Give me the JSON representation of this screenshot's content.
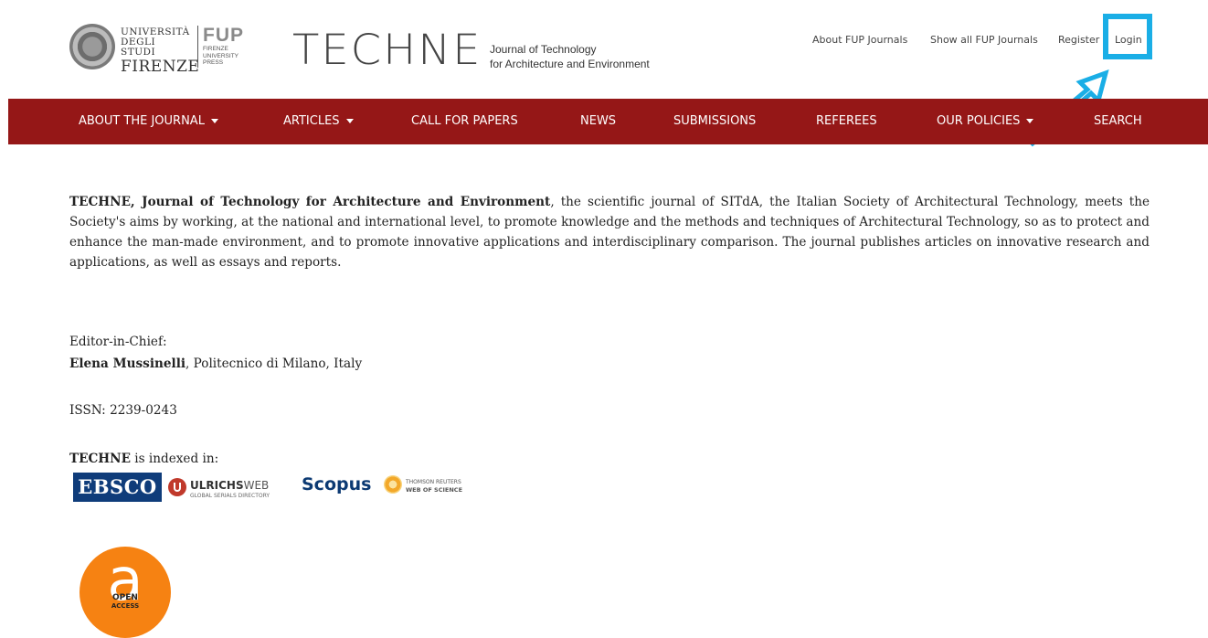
{
  "header": {
    "university": {
      "line1": "UNIVERSITÀ",
      "line2": "DEGLI STUDI",
      "line3": "FIRENZE"
    },
    "fup": {
      "big": "FUP",
      "line1": "FIRENZE",
      "line2": "UNIVERSITY",
      "line3": "PRESS"
    },
    "journal_logo": "TECHNE",
    "tagline_line1": "Journal of Technology",
    "tagline_line2": "for Architecture and Environment"
  },
  "topnav": {
    "about_fup": "About FUP Journals",
    "show_all": "Show all FUP Journals",
    "register": "Register",
    "login": "Login"
  },
  "mainnav": {
    "about": "ABOUT THE JOURNAL",
    "articles": "ARTICLES",
    "call": "CALL FOR PAPERS",
    "news": "NEWS",
    "submissions": "SUBMISSIONS",
    "referees": "REFEREES",
    "policies": "OUR POLICIES",
    "search": "SEARCH"
  },
  "content": {
    "intro_bold": "TECHNE, Journal of Technology for Architecture and Environment",
    "intro_rest": ", the scientific journal of SITdA, the Italian Society of Architectural Technology, meets the Society's aims by working, at the national and international level, to promote knowledge and the methods and techniques of Architectural Technology, so as to protect and enhance the man-made environment, and to promote innovative applications and interdisciplinary comparison. The journal publishes articles on innovative research and applications, as well as essays and reports.",
    "editor_label": "Editor-in-Chief:",
    "editor_name": "Elena Mussinelli",
    "editor_affiliation": ", Politecnico di Milano, Italy",
    "issn": "ISSN: 2239-0243",
    "indexed_bold": "TECHNE",
    "indexed_rest": " is indexed in:"
  },
  "index_logos": {
    "ebsco": "EBSCO",
    "ulrichs_main": "ULRICHS",
    "ulrichs_web": "WEB",
    "ulrichs_sub": "GLOBAL SERIALS DIRECTORY",
    "scopus": "Scopus",
    "thomson_top": "THOMSON REUTERS",
    "thomson_bottom": "WEB OF SCIENCE"
  },
  "open_access": {
    "line1": "OPEN",
    "line2": "ACCESS"
  },
  "colors": {
    "navbar": "#951717",
    "highlight": "#1aaee6",
    "open_access": "#f68212"
  }
}
